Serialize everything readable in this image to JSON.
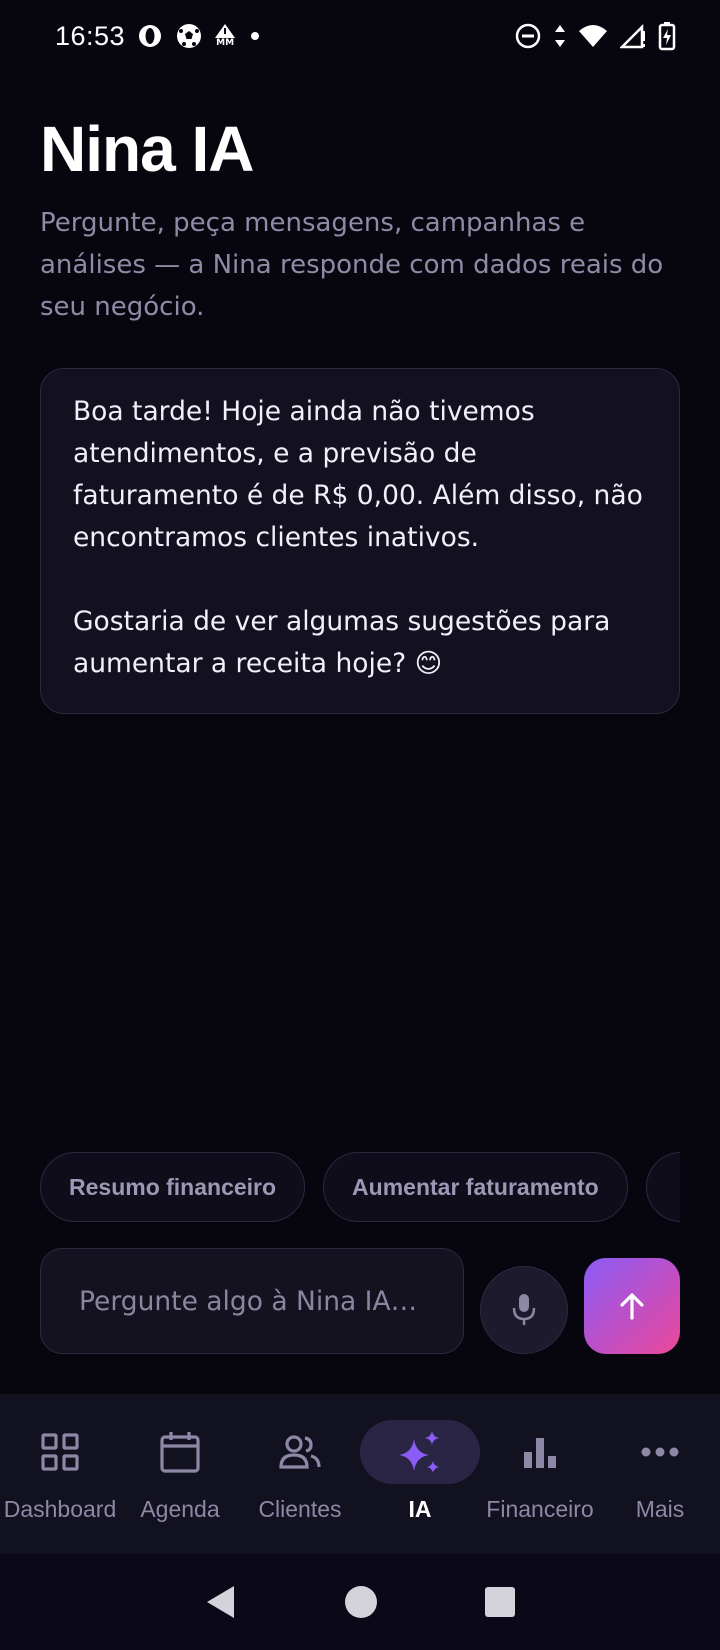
{
  "status_bar": {
    "time": "16:53",
    "left_icons": [
      "opera-icon",
      "soccer-ball-icon",
      "mm-alert-icon",
      "dot-icon"
    ],
    "right_icons": [
      "do-not-disturb-icon",
      "data-arrows-icon",
      "wifi-icon",
      "signal-icon",
      "battery-charging-icon"
    ],
    "mm_label": "MM"
  },
  "header": {
    "title": "Nina IA",
    "subtitle": "Pergunte, peça mensagens, campanhas e análises — a Nina responde com dados reais do seu negócio."
  },
  "chat": {
    "message": "Boa tarde! Hoje ainda não tivemos atendimentos, e a previsão de faturamento é de R$ 0,00. Além disso, não encontramos clientes inativos.\n\nGostaria de ver algumas sugestões para aumentar a receita hoje? 😊"
  },
  "suggestions": [
    {
      "label": "Resumo financeiro"
    },
    {
      "label": "Aumentar faturamento"
    },
    {
      "label": ""
    }
  ],
  "composer": {
    "placeholder": "Pergunte algo à Nina IA…",
    "mic_icon": "microphone-icon",
    "send_icon": "arrow-up-icon"
  },
  "bottom_nav": {
    "items": [
      {
        "label": "Dashboard",
        "icon": "grid-icon",
        "active": false
      },
      {
        "label": "Agenda",
        "icon": "calendar-icon",
        "active": false
      },
      {
        "label": "Clientes",
        "icon": "people-icon",
        "active": false
      },
      {
        "label": "IA",
        "icon": "sparkles-icon",
        "active": true
      },
      {
        "label": "Financeiro",
        "icon": "bar-chart-icon",
        "active": false
      },
      {
        "label": "Mais",
        "icon": "more-dots-icon",
        "active": false
      }
    ]
  },
  "colors": {
    "background": "#07060f",
    "accent": "#8b5cf6",
    "accent_pink": "#ec4899",
    "muted_text": "#8f8aa6"
  }
}
